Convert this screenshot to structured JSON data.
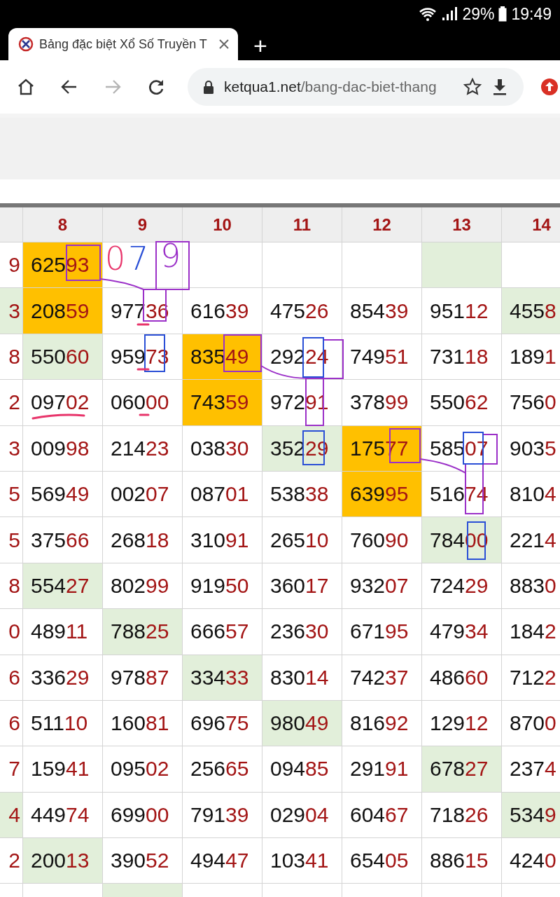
{
  "status_bar": {
    "battery": "29%",
    "time": "19:49"
  },
  "tab": {
    "title": "Bảng đặc biệt Xổ Số Truyền T",
    "new_tab": "+"
  },
  "address_bar": {
    "host": "ketqua1.net",
    "path": "/bang-dac-biet-thang",
    "forward_disabled": true
  },
  "table": {
    "columns": [
      "8",
      "9",
      "10",
      "11",
      "12",
      "13",
      "14"
    ],
    "rows": [
      {
        "cut": {
          "text": "9"
        },
        "cells": [
          {
            "text": "62593",
            "color": "#ffc000"
          },
          {},
          {},
          {},
          {},
          {
            "color": "#e2efda"
          },
          {}
        ]
      },
      {
        "cut": {
          "text": "3",
          "color": "#e2efda"
        },
        "cells": [
          {
            "text": "20859",
            "color": "#ffc000"
          },
          {
            "text": "97736"
          },
          {
            "text": "61639"
          },
          {
            "text": "47526"
          },
          {
            "text": "85439"
          },
          {
            "text": "95112"
          },
          {
            "text": "4558",
            "color": "#e2efda"
          }
        ]
      },
      {
        "cut": {
          "text": "8"
        },
        "cells": [
          {
            "text": "55060",
            "color": "#e2efda"
          },
          {
            "text": "95973"
          },
          {
            "text": "83549",
            "color": "#ffc000"
          },
          {
            "text": "29224"
          },
          {
            "text": "74951"
          },
          {
            "text": "73118"
          },
          {
            "text": "1891"
          }
        ]
      },
      {
        "cut": {
          "text": "2"
        },
        "cells": [
          {
            "text": "09702"
          },
          {
            "text": "06000"
          },
          {
            "text": "74359",
            "color": "#ffc000"
          },
          {
            "text": "97291"
          },
          {
            "text": "37899"
          },
          {
            "text": "55062"
          },
          {
            "text": "7560"
          }
        ]
      },
      {
        "cut": {
          "text": "3"
        },
        "cells": [
          {
            "text": "00998"
          },
          {
            "text": "21423"
          },
          {
            "text": "03830"
          },
          {
            "text": "35229",
            "color": "#e2efda"
          },
          {
            "text": "17577",
            "color": "#ffc000"
          },
          {
            "text": "58507"
          },
          {
            "text": "9035"
          }
        ]
      },
      {
        "cut": {
          "text": "5"
        },
        "cells": [
          {
            "text": "56949"
          },
          {
            "text": "00207"
          },
          {
            "text": "08701"
          },
          {
            "text": "53838"
          },
          {
            "text": "63995",
            "color": "#ffc000"
          },
          {
            "text": "51674"
          },
          {
            "text": "8104"
          }
        ]
      },
      {
        "cut": {
          "text": "5"
        },
        "cells": [
          {
            "text": "37566"
          },
          {
            "text": "26818"
          },
          {
            "text": "31091"
          },
          {
            "text": "26510"
          },
          {
            "text": "76090"
          },
          {
            "text": "78400",
            "color": "#e2efda"
          },
          {
            "text": "2214"
          }
        ]
      },
      {
        "cut": {
          "text": "8"
        },
        "cells": [
          {
            "text": "55427",
            "color": "#e2efda"
          },
          {
            "text": "80299"
          },
          {
            "text": "91950"
          },
          {
            "text": "36017"
          },
          {
            "text": "93207"
          },
          {
            "text": "72429"
          },
          {
            "text": "8830"
          }
        ]
      },
      {
        "cut": {
          "text": "0"
        },
        "cells": [
          {
            "text": "48911"
          },
          {
            "text": "78825",
            "color": "#e2efda"
          },
          {
            "text": "66657"
          },
          {
            "text": "23630"
          },
          {
            "text": "67195"
          },
          {
            "text": "47934"
          },
          {
            "text": "1842"
          }
        ]
      },
      {
        "cut": {
          "text": "6"
        },
        "cells": [
          {
            "text": "33629"
          },
          {
            "text": "97887"
          },
          {
            "text": "33433",
            "color": "#e2efda"
          },
          {
            "text": "83014"
          },
          {
            "text": "74237"
          },
          {
            "text": "48660"
          },
          {
            "text": "7122"
          }
        ]
      },
      {
        "cut": {
          "text": "6"
        },
        "cells": [
          {
            "text": "51110"
          },
          {
            "text": "16081"
          },
          {
            "text": "69675"
          },
          {
            "text": "98049",
            "color": "#e2efda"
          },
          {
            "text": "81692"
          },
          {
            "text": "12912"
          },
          {
            "text": "8700"
          }
        ]
      },
      {
        "cut": {
          "text": "7"
        },
        "cells": [
          {
            "text": "15941"
          },
          {
            "text": "09502"
          },
          {
            "text": "25665"
          },
          {
            "text": "09485"
          },
          {
            "text": "29191"
          },
          {
            "text": "67827",
            "color": "#e2efda"
          },
          {
            "text": "2374"
          }
        ]
      },
      {
        "cut": {
          "text": "4",
          "color": "#e2efda"
        },
        "cells": [
          {
            "text": "44974"
          },
          {
            "text": "69900"
          },
          {
            "text": "79139"
          },
          {
            "text": "02904"
          },
          {
            "text": "60467"
          },
          {
            "text": "71826"
          },
          {
            "text": "5349",
            "color": "#e2efda"
          }
        ]
      },
      {
        "cut": {
          "text": "2"
        },
        "cells": [
          {
            "text": "20013",
            "color": "#e2efda"
          },
          {
            "text": "39052"
          },
          {
            "text": "49447"
          },
          {
            "text": "10341"
          },
          {
            "text": "65405"
          },
          {
            "text": "88615"
          },
          {
            "text": "4240"
          }
        ]
      },
      {
        "cut": {},
        "cells": [
          {},
          {
            "color": "#e2efda"
          },
          {},
          {},
          {},
          {},
          {}
        ]
      }
    ]
  },
  "annotations": [
    {
      "text": "0",
      "color": "#e8356b"
    },
    {
      "text": "7",
      "color": "#2a4fd6"
    },
    {
      "text": "9",
      "color": "#9b30c8"
    }
  ]
}
